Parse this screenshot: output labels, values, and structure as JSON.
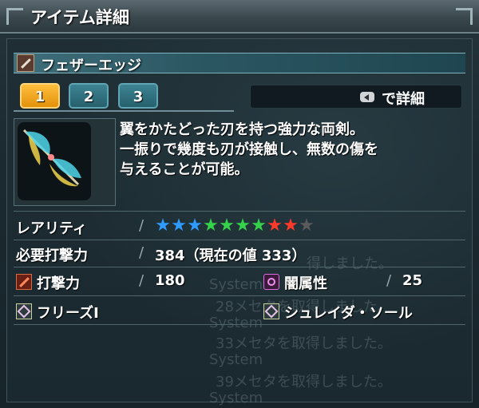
{
  "window": {
    "title": "アイテム詳細"
  },
  "item": {
    "name": "フェザーエッジ",
    "icon": "sword-icon"
  },
  "tabs": [
    {
      "label": "1",
      "active": true
    },
    {
      "label": "2",
      "active": false
    },
    {
      "label": "3",
      "active": false
    }
  ],
  "detail_button": {
    "key_icon": "key-left-icon",
    "label": "で詳細"
  },
  "description": {
    "lines": [
      "翼をかたどった刃を持つ強力な両剣。",
      "一振りで幾度も刃が接触し、無数の傷を",
      "与えることが可能。"
    ]
  },
  "rarity": {
    "label": "レアリティ",
    "value": 9,
    "max": 10,
    "star_colors": [
      "#2f9bff",
      "#2f9bff",
      "#2f9bff",
      "#35d14a",
      "#35d14a",
      "#35d14a",
      "#35d14a",
      "#ff3a2a",
      "#ff3a2a",
      "#5a5a5a"
    ]
  },
  "required_power": {
    "label": "必要打撃力",
    "value": "384（現在の値 333）"
  },
  "attack": {
    "label": "打撃力",
    "value": "180",
    "icon": "attack-icon"
  },
  "element": {
    "label": "闇属性",
    "value": "25",
    "icon": "dark-element-icon"
  },
  "abilities": [
    {
      "label": "フリーズI",
      "icon": "ability-icon"
    },
    {
      "label": "シュレイダ・ソール",
      "icon": "ability-icon"
    }
  ],
  "background_log": [
    "得しました。",
    "System",
    "28メセタを取得しました。",
    "System",
    "33メセタを取得しました。",
    "System",
    "39メセタを取得しました。",
    "System"
  ]
}
